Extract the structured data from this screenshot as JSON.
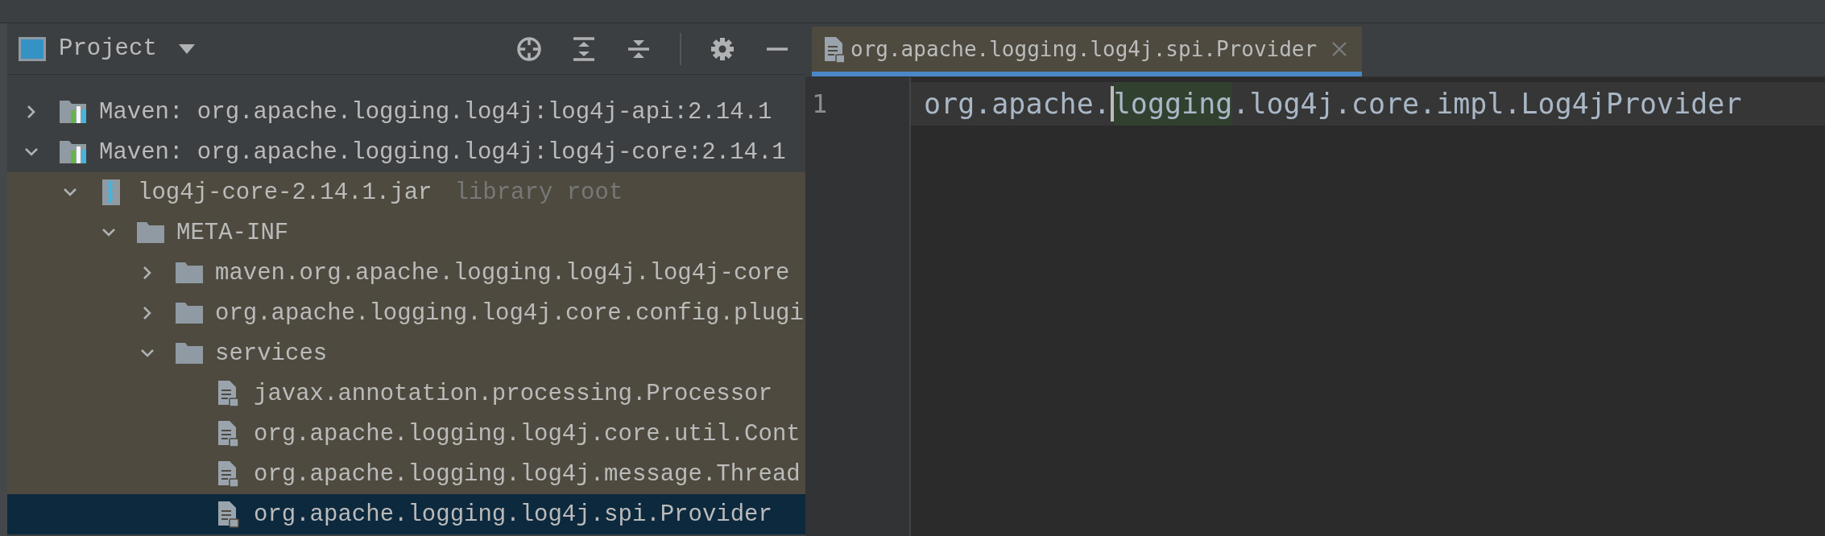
{
  "project_panel": {
    "title": "Project",
    "tree": [
      {
        "label": "Maven: org.apache.logging.log4j:log4j-api:2.14.1",
        "kind": "library",
        "expanded": false,
        "selected": false
      },
      {
        "label": "Maven: org.apache.logging.log4j:log4j-core:2.14.1",
        "kind": "library",
        "expanded": true,
        "selected": false,
        "children": [
          {
            "label": "log4j-core-2.14.1.jar",
            "hint": "library root",
            "kind": "archive",
            "expanded": true,
            "selected": false,
            "color": "#4e4a3f",
            "children": [
              {
                "label": "META-INF",
                "kind": "folder",
                "expanded": true,
                "selected": false,
                "color": "#4e4a3f",
                "children": [
                  {
                    "label": "maven.org.apache.logging.log4j.log4j-core",
                    "kind": "folder",
                    "expanded": false,
                    "selected": false,
                    "color": "#4e4a3f"
                  },
                  {
                    "label": "org.apache.logging.log4j.core.config.plugi",
                    "kind": "folder",
                    "expanded": false,
                    "selected": false,
                    "color": "#4e4a3f"
                  },
                  {
                    "label": "services",
                    "kind": "folder",
                    "expanded": true,
                    "selected": false,
                    "color": "#4e4a3f",
                    "children": [
                      {
                        "label": "javax.annotation.processing.Processor",
                        "kind": "file",
                        "selected": false,
                        "color": "#4e4a3f"
                      },
                      {
                        "label": "org.apache.logging.log4j.core.util.Cont",
                        "kind": "file",
                        "selected": false,
                        "color": "#4e4a3f"
                      },
                      {
                        "label": "org.apache.logging.log4j.message.Thread",
                        "kind": "file",
                        "selected": false,
                        "color": "#4e4a3f"
                      },
                      {
                        "label": "org.apache.logging.log4j.spi.Provider",
                        "kind": "file",
                        "selected": true
                      }
                    ]
                  }
                ]
              }
            ]
          }
        ]
      }
    ]
  },
  "editor": {
    "tabs": [
      {
        "label": "org.apache.logging.log4j.spi.Provider",
        "selected": true
      }
    ],
    "lines": [
      {
        "number": "1",
        "segments": [
          {
            "text": "org.apache.",
            "kind": "plain"
          },
          {
            "text": "logging",
            "kind": "match",
            "caret_before": true
          },
          {
            "text": ".log4j.core.impl.Log4jProvider",
            "kind": "plain"
          }
        ]
      }
    ]
  }
}
